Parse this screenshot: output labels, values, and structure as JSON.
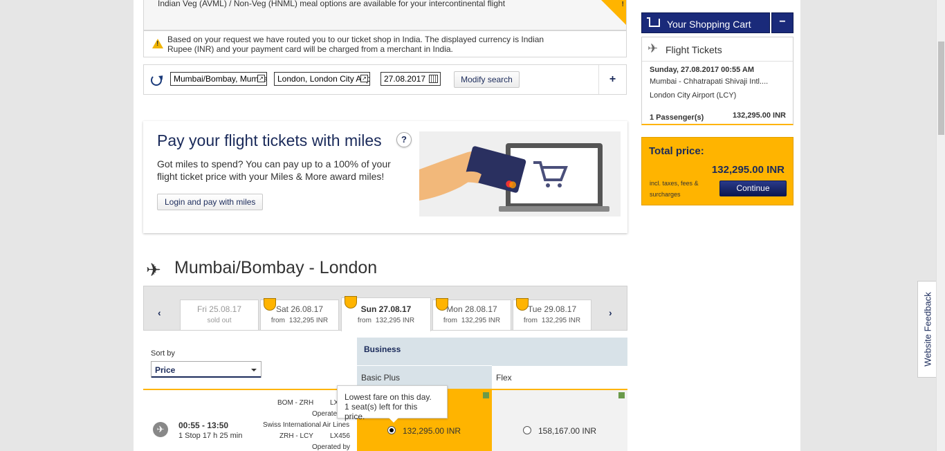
{
  "meal_notice": {
    "text": "Indian Veg (AVML) / Non-Veg (HNML) meal options are available for your intercontinental flight",
    "corner_mark": "!"
  },
  "routing_notice": {
    "text": "Based on your request we have routed you to our ticket shop in India. The displayed currency is Indian Rupee (INR) and your payment card will be charged from a merchant in India."
  },
  "search": {
    "origin": "Mumbai/Bombay, Mumbai",
    "destination": "London, London City Airport",
    "date": "27.08.2017",
    "modify_label": "Modify search",
    "expand_label": "+"
  },
  "miles_promo": {
    "title": "Pay your flight tickets with miles",
    "help": "?",
    "description": "Got miles to spend? You can pay up to a 100% of your flight ticket price with your Miles & More award miles!",
    "login_label": "Login and pay with miles"
  },
  "route": {
    "title": "Mumbai/Bombay - London"
  },
  "date_tabs": {
    "prev": "‹",
    "next": "›",
    "tabs": [
      {
        "date": "Fri 25.08.17",
        "from": "",
        "price": "sold out"
      },
      {
        "date": "Sat 26.08.17",
        "from": "from",
        "price": "132,295 INR"
      },
      {
        "date": "Sun 27.08.17",
        "from": "from",
        "price": "132,295 INR"
      },
      {
        "date": "Mon 28.08.17",
        "from": "from",
        "price": "132,295 INR"
      },
      {
        "date": "Tue 29.08.17",
        "from": "from",
        "price": "132,295 INR"
      }
    ],
    "selected_index": 2
  },
  "sort": {
    "label": "Sort by",
    "value": "Price"
  },
  "fares": {
    "cabin": "Business",
    "columns": [
      "Basic Plus",
      "Flex"
    ],
    "tooltip": [
      "Lowest fare on this day.",
      "1 seat(s) left for this price."
    ]
  },
  "flight": {
    "times": "00:55 - 13:50",
    "duration": "1 Stop 17 h 25 min",
    "seg1_route": "BOM - ZRH",
    "seg1_flight": "LX",
    "seg1_operated": "Operated",
    "carrier": "Swiss International Air Lines",
    "seg2_route": "ZRH - LCY",
    "seg2_flight": "LX456",
    "seg2_operated": "Operated by",
    "prices": [
      "132,295.00 INR",
      "158,167.00 INR"
    ],
    "selected_fare": 0
  },
  "cart": {
    "title": "Your Shopping Cart",
    "collapse": "−",
    "section": "Flight Tickets",
    "date": "Sunday, 27.08.2017 00:55 AM",
    "from": "Mumbai - Chhatrapati Shivaji Intl....",
    "to": "London City Airport (LCY)",
    "passengers": "1 Passenger(s)",
    "amount": "132,295.00 INR"
  },
  "total": {
    "label": "Total price:",
    "value": "132,295.00 INR",
    "note": "incl. taxes, fees & surcharges",
    "continue_label": "Continue"
  },
  "feedback": {
    "label": "Website Feedback"
  },
  "colors": {
    "accent": "#ffb400",
    "brand": "#1a2a7a"
  }
}
